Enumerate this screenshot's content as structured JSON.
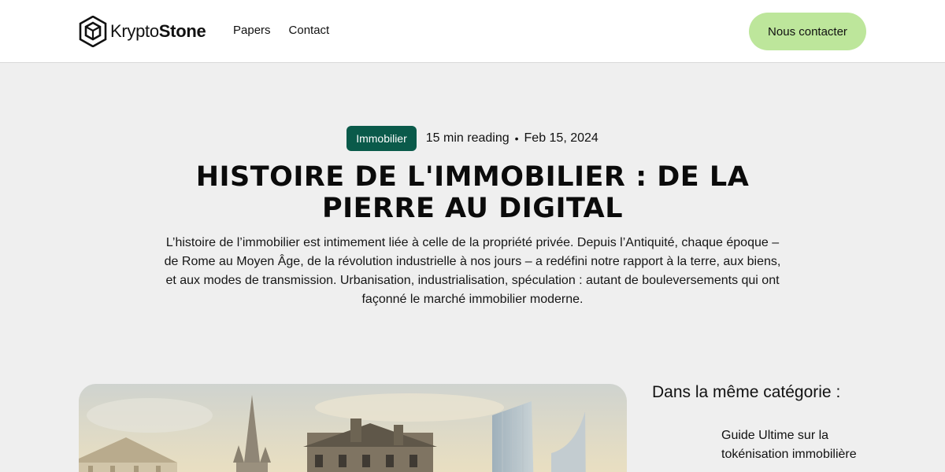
{
  "header": {
    "logo_light": "Krypto",
    "logo_bold": "Stone",
    "nav": [
      {
        "label": "Papers"
      },
      {
        "label": "Contact"
      }
    ],
    "cta_label": "Nous contacter",
    "cta_color": "#bde69b"
  },
  "article": {
    "category": "Immobilier",
    "category_color": "#0a5a4a",
    "reading_time": "15 min reading",
    "separator": "•",
    "date": "Feb 15, 2024",
    "title": "HISTOIRE DE L'IMMOBILIER : DE LA PIERRE AU DIGITAL",
    "lead": "L’histoire de l’immobilier est intimement liée à celle de la propriété privée. Depuis l’Antiquité, chaque époque – de Rome au Moyen Âge, de la révolution industrielle à nos jours – a redéfini notre rapport à la terre, aux biens, et aux modes de transmission. Urbanisation, industrialisation, spéculation : autant de bouleversements qui ont façonné le marché immobilier moderne."
  },
  "sidebar": {
    "title": "Dans la même catégorie :",
    "items": [
      {
        "label": "Guide Ultime sur la tokénisation immobilière"
      }
    ]
  }
}
